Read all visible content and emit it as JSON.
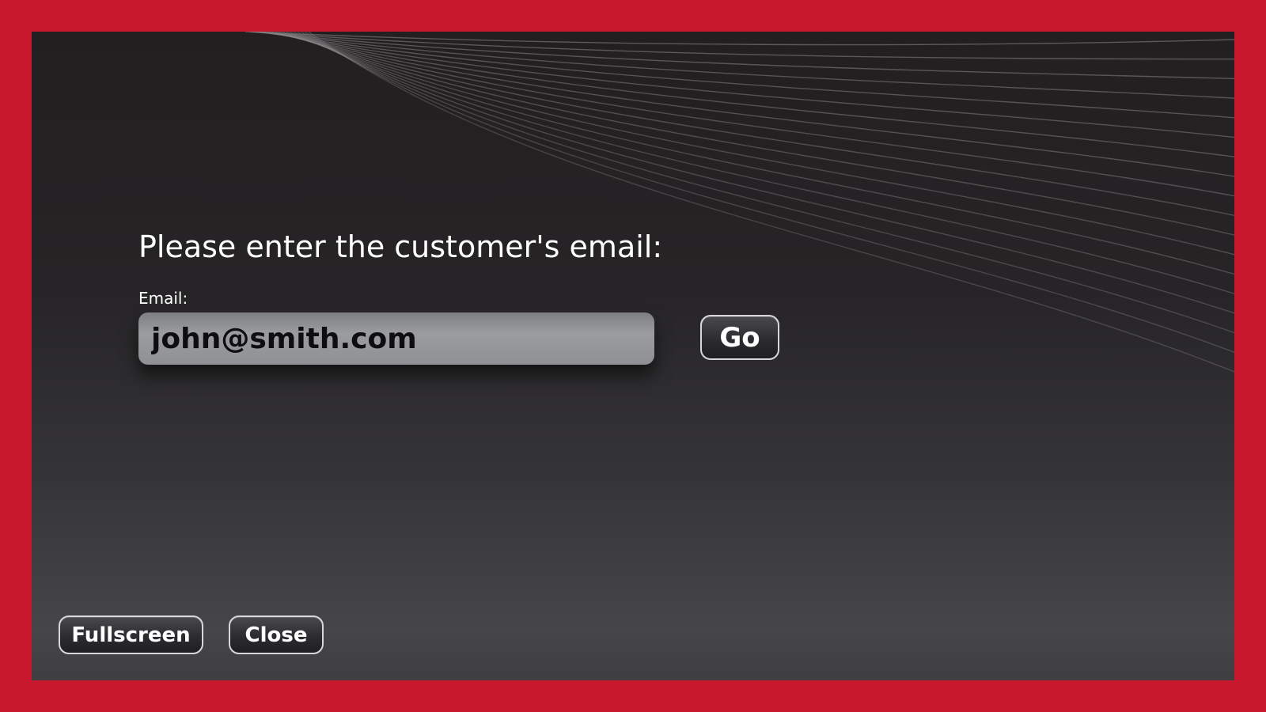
{
  "colors": {
    "border": "#c8182d",
    "background": "#262426",
    "input_fill": "#96989c",
    "text": "#ffffff"
  },
  "prompt": {
    "title": "Please enter the customer's email:"
  },
  "email_field": {
    "label": "Email:",
    "value": "john@smith.com"
  },
  "actions": {
    "go_label": "Go",
    "fullscreen_label": "Fullscreen",
    "close_label": "Close"
  }
}
